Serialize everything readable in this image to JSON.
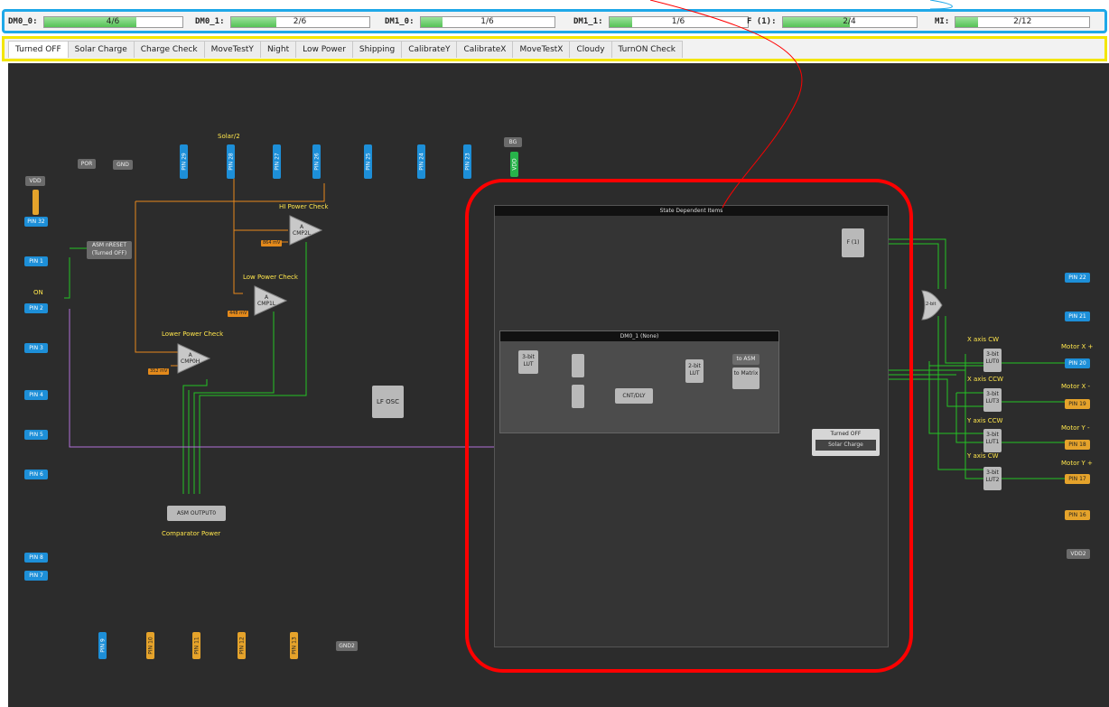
{
  "resources": [
    {
      "label": "DM0_0:",
      "value": "4/6",
      "fraction": 0.667
    },
    {
      "label": "DM0_1:",
      "value": "2/6",
      "fraction": 0.333
    },
    {
      "label": "DM1_0:",
      "value": "1/6",
      "fraction": 0.167
    },
    {
      "label": "DM1_1:",
      "value": "1/6",
      "fraction": 0.167
    },
    {
      "label": "F (1):",
      "value": "2/4",
      "fraction": 0.5
    },
    {
      "label": "MI:",
      "value": "2/12",
      "fraction": 0.167
    }
  ],
  "tabs": [
    "Turned OFF",
    "Solar Charge",
    "Charge Check",
    "MoveTestY",
    "Night",
    "Low Power",
    "Shipping",
    "CalibrateY",
    "CalibrateX",
    "MoveTestX",
    "Cloudy",
    "TurnON Check"
  ],
  "active_tab": "Turned OFF",
  "left_pins": {
    "vdd": "VDD",
    "pin32": "PIN 32",
    "pin1": "PIN 1",
    "on": "ON",
    "pin2": "PIN 2",
    "pin3": "PIN 3",
    "pin4": "PIN 4",
    "pin5": "PIN 5",
    "pin6": "PIN 6",
    "pin8": "PIN 8",
    "pin7": "PIN 7"
  },
  "top_pins": {
    "pin29": "PIN 29",
    "pin28": "PIN 28",
    "pin27": "PIN 27",
    "pin26": "PIN 26",
    "pin25": "PIN 25",
    "pin24": "PIN 24",
    "pin23": "PIN 23",
    "solar2": "Solar/2",
    "bg": "BG",
    "vdd_v": "VDD"
  },
  "bottom_pins": {
    "pin9": "PIN 9",
    "pin10": "PIN 10",
    "pin11": "PIN 11",
    "pin12": "PIN 12",
    "pin13": "PIN 13",
    "gnd2": "GND2"
  },
  "blocks": {
    "por": "POR",
    "gnd": "GND",
    "asm_reset": "ASM nRESET",
    "asm_reset_sub": "(Turned OFF)",
    "hi_power_check": "HI Power Check",
    "cmp2l": "CMP2L",
    "mv_hi": "864 mV",
    "low_power_check": "Low Power Check",
    "cmp1l": "CMP1L",
    "mv_low": "448 mV",
    "lower_power_check": "Lower Power Check",
    "cmp0h": "CMP0H",
    "mv_lower": "352 mV",
    "a_letter": "A",
    "lfosc": "LF OSC",
    "asm_output": "ASM OUTPUT0",
    "comparator_power": "Comparator Power"
  },
  "sdi": {
    "title": "State Dependent Items",
    "f1": "F (1)",
    "dm_title": "DM0_1 (None)",
    "lut3": "3-bit LUT",
    "lut2": "2-bit LUT",
    "cnt": "CNT/DLY",
    "to_asm": "to ASM",
    "to_matrix": "to Matrix"
  },
  "state_box": {
    "current": "Turned OFF",
    "next": "Solar Charge"
  },
  "right": {
    "xor": "2-bit",
    "pin22": "PIN 22",
    "pin21": "PIN 21",
    "x_cw": "X axis CW",
    "motor_xp": "Motor X +",
    "pin20": "PIN 20",
    "lut0": "3-bit LUT0",
    "x_ccw": "X axis CCW",
    "motor_xm": "Motor X -",
    "pin19": "PIN 19",
    "lut3": "3-bit LUT3",
    "y_ccw": "Y axis CCW",
    "motor_ym": "Motor Y -",
    "pin18": "PIN 18",
    "lut1": "3-bit LUT1",
    "y_cw": "Y axis CW",
    "motor_yp": "Motor Y +",
    "pin17": "PIN 17",
    "lut2": "3-bit LUT2",
    "pin16": "PIN 16",
    "vdd2": "VDD2"
  },
  "colors": {
    "resource_border": "#1fa8e8",
    "tab_border": "#f3e600",
    "highlight": "#ff0000",
    "wire_green": "#23c423",
    "wire_orange": "#e8891b",
    "wire_purple": "#b070d8",
    "pin_blue": "#1d8fd8",
    "pin_yellow": "#e5a32b"
  }
}
